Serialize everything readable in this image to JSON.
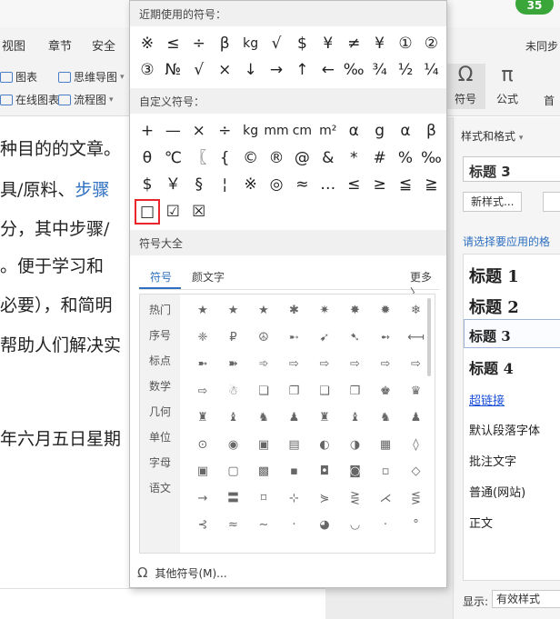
{
  "ribbon": {
    "tabs": [
      "视图",
      "章节",
      "安全"
    ],
    "row1_items": [
      {
        "label": "图表",
        "icon": "chart-icon"
      },
      {
        "label": "思维导图",
        "icon": "mindmap-icon"
      }
    ],
    "row2_items": [
      {
        "label": "在线图表",
        "icon": "online-chart-icon"
      },
      {
        "label": "流程图",
        "icon": "flowchart-icon"
      }
    ],
    "sync_label": "未同步",
    "badge_count": "35",
    "symbol_btn_label": "符号",
    "formula_btn_label": "公式",
    "first_label": "首",
    "omega_glyph": "Ω",
    "pi_glyph": "π"
  },
  "document": {
    "lines": [
      {
        "text": "种目的的文章。"
      },
      {
        "text": "具/原料、",
        "link": "步骤"
      },
      {
        "text": "分，其中步骤/"
      },
      {
        "text": "。便于学习和"
      },
      {
        "text": "必要），和简明"
      },
      {
        "text": "帮助人们解决实"
      },
      {
        "text": "年六月五日星期"
      }
    ]
  },
  "styles_pane": {
    "title": "样式和格式",
    "current_style": "标题 3",
    "new_style_button": "新样式...",
    "hint": "请选择要应用的格",
    "items": [
      "标题 1",
      "标题 2",
      "标题 3",
      "标题 4",
      "超链接",
      "默认段落字体",
      "批注文字",
      "普通(网站)",
      "正文"
    ],
    "footer_label": "显示:",
    "footer_value": "有效样式"
  },
  "symbol_popup": {
    "recent_title": "近期使用的符号：",
    "recent_symbols": [
      [
        "※",
        "≤",
        "÷",
        "β",
        "kg",
        "√",
        "$",
        "¥",
        "≠",
        "¥",
        "①",
        "②"
      ],
      [
        "③",
        "№",
        "√",
        "×",
        "↓",
        "→",
        "↑",
        "←",
        "‰",
        "¾",
        "½",
        "¼"
      ]
    ],
    "custom_title": "自定义符号：",
    "custom_symbols": [
      [
        "+",
        "—",
        "×",
        "÷",
        "kg",
        "mm",
        "cm",
        "m²",
        "α",
        "g",
        "α",
        "β"
      ],
      [
        "θ",
        "℃",
        "〖",
        "{",
        "©",
        "®",
        "@",
        "&",
        "*",
        "#",
        "%",
        "‰"
      ],
      [
        "$",
        "￥",
        "§",
        "¦",
        "※",
        "◎",
        "≈",
        "…",
        "≤",
        "≥",
        "≦",
        "≧"
      ],
      [
        "□",
        "☑",
        "☒"
      ]
    ],
    "selected_symbol": "□",
    "library_title": "符号大全",
    "tabs": [
      "符号",
      "颜文字"
    ],
    "more_label": "更多 〉",
    "categories": [
      "热门",
      "序号",
      "标点",
      "数学",
      "几何",
      "单位",
      "字母",
      "语文"
    ],
    "library_symbols": [
      [
        "★",
        "★",
        "★",
        "✱",
        "✷",
        "✸",
        "✹",
        "❄"
      ],
      [
        "❈",
        "₽",
        "☮",
        "➸",
        "➹",
        "➷",
        "➻",
        "⟻"
      ],
      [
        "➼",
        "➽",
        "➾",
        "⇨",
        "⇨",
        "⇨",
        "⇨",
        "⇨"
      ],
      [
        "⇨",
        "☃",
        "❏",
        "❐",
        "❑",
        "❒",
        "♚",
        "♛"
      ],
      [
        "♜",
        "♝",
        "♞",
        "♟",
        "♜",
        "♝",
        "♞",
        "♟"
      ],
      [
        "⊙",
        "◉",
        "▣",
        "▤",
        "◐",
        "◑",
        "▦",
        "◊"
      ],
      [
        "▣",
        "▢",
        "▩",
        "▪",
        "◘",
        "◙",
        "▫",
        "◇"
      ],
      [
        "→",
        "〓",
        "⌑",
        "⊹",
        "⋟",
        "⋛",
        "⋌",
        "⋚"
      ],
      [
        "⊰",
        "≈",
        "∼",
        "·",
        "◕",
        "◡",
        "·",
        "°"
      ]
    ],
    "other_label": "其他符号(M)...",
    "omega_icon_glyph": "Ω"
  },
  "colors": {
    "accent": "#2d6fc0",
    "selection": "#e8262c",
    "badge": "#3aa63a"
  }
}
